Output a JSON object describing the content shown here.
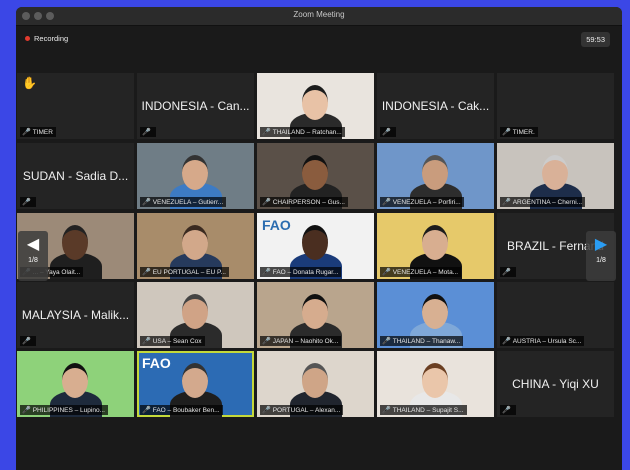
{
  "window": {
    "title": "Zoom Meeting"
  },
  "recording": {
    "label": "Recording"
  },
  "timer": "59:53",
  "pagination": {
    "left": "1/8",
    "right": "1/8"
  },
  "tiles": [
    {
      "name": "TIMER",
      "big": "",
      "kind": "dark",
      "hand": true
    },
    {
      "name": "",
      "big": "INDONESIA - Can...",
      "kind": "dark"
    },
    {
      "name": "THAILAND – Ratchan...",
      "big": "",
      "kind": "video"
    },
    {
      "name": "",
      "big": "INDONESIA - Cak...",
      "kind": "dark"
    },
    {
      "name": "TIMER.",
      "big": "",
      "kind": "dark"
    },
    {
      "name": "",
      "big": "SUDAN - Sadia D...",
      "kind": "dark"
    },
    {
      "name": "VENEZUELA – Gutierr...",
      "big": "",
      "kind": "video"
    },
    {
      "name": "CHAIRPERSON – Gus...",
      "big": "",
      "kind": "video"
    },
    {
      "name": "VENEZUELA – Porfiri...",
      "big": "",
      "kind": "video"
    },
    {
      "name": "ARGENTINA – Cherni...",
      "big": "",
      "kind": "video"
    },
    {
      "name": "... – Yaya Olait...",
      "big": "",
      "kind": "video"
    },
    {
      "name": "EU PORTUGAL – EU P...",
      "big": "",
      "kind": "video"
    },
    {
      "name": "FAO – Donata Rugar...",
      "big": "",
      "kind": "video"
    },
    {
      "name": "VENEZUELA – Mota...",
      "big": "",
      "kind": "video"
    },
    {
      "name": "",
      "big": "BRAZIL - Fernand",
      "kind": "dark"
    },
    {
      "name": "",
      "big": "MALAYSIA - Malik...",
      "kind": "dark"
    },
    {
      "name": "USA – Sean Cox",
      "big": "",
      "kind": "video"
    },
    {
      "name": "JAPAN – Naohito Ok...",
      "big": "",
      "kind": "video"
    },
    {
      "name": "THAILAND – Thanaw...",
      "big": "",
      "kind": "video"
    },
    {
      "name": "AUSTRIA – Ursula Sc...",
      "big": "",
      "kind": "dark"
    },
    {
      "name": "PHILIPPINES – Lupino...",
      "big": "",
      "kind": "video"
    },
    {
      "name": "FAO – Boubaker Ben...",
      "big": "",
      "kind": "video",
      "active": true
    },
    {
      "name": "PORTUGAL – Alexan...",
      "big": "",
      "kind": "video"
    },
    {
      "name": "THAILAND – Supajit S...",
      "big": "",
      "kind": "video"
    },
    {
      "name": "",
      "big": "CHINA - Yiqi XU",
      "kind": "dark"
    }
  ],
  "fao_labels": {
    "tile12": "FAO",
    "tile21": "FAO"
  },
  "colors": {
    "accent_active": "#c4d93a",
    "record": "#e23b2e",
    "background": "#3b47e6"
  }
}
